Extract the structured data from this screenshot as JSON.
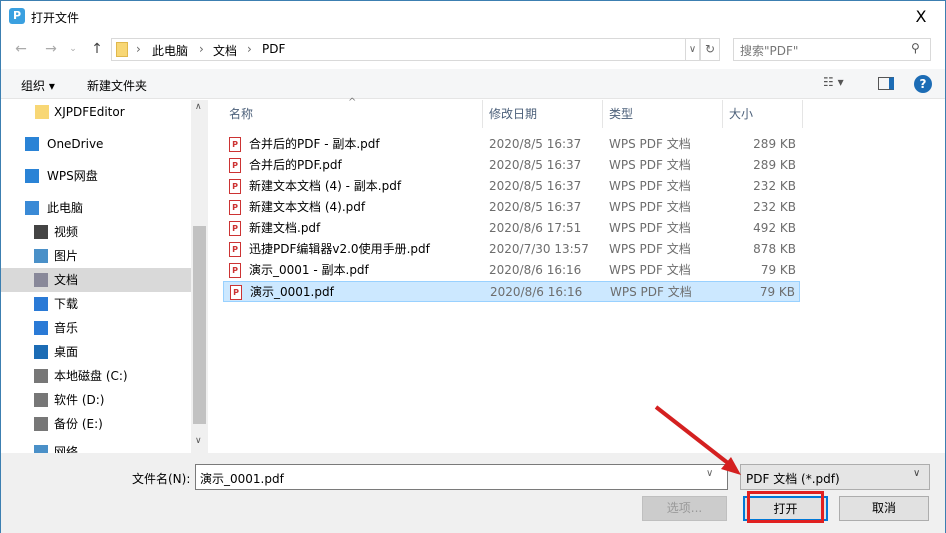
{
  "window": {
    "title": "打开文件",
    "close": "X"
  },
  "address": {
    "crumbs": [
      "此电脑",
      "文档",
      "PDF"
    ],
    "search_placeholder": "搜索\"PDF\""
  },
  "toolbar": {
    "organize": "组织 ▾",
    "new_folder": "新建文件夹"
  },
  "sidebar": {
    "items": [
      {
        "label": "XJPDFEditor",
        "icon": "folder-icon"
      },
      {
        "label": "OneDrive",
        "icon": "cloud-icon"
      },
      {
        "label": "WPS网盘",
        "icon": "cloud-icon"
      },
      {
        "label": "此电脑",
        "icon": "computer-icon"
      },
      {
        "label": "视频",
        "icon": "video-icon"
      },
      {
        "label": "图片",
        "icon": "picture-icon"
      },
      {
        "label": "文档",
        "icon": "document-icon"
      },
      {
        "label": "下载",
        "icon": "download-icon"
      },
      {
        "label": "音乐",
        "icon": "music-icon"
      },
      {
        "label": "桌面",
        "icon": "desktop-icon"
      },
      {
        "label": "本地磁盘 (C:)",
        "icon": "drive-icon"
      },
      {
        "label": "软件 (D:)",
        "icon": "drive-icon"
      },
      {
        "label": "备份 (E:)",
        "icon": "drive-icon"
      },
      {
        "label": "网络",
        "icon": "network-icon"
      }
    ]
  },
  "columns": [
    "名称",
    "修改日期",
    "类型",
    "大小"
  ],
  "files": [
    {
      "name": "合并后的PDF - 副本.pdf",
      "date": "2020/8/5 16:37",
      "type": "WPS PDF 文档",
      "size": "289 KB"
    },
    {
      "name": "合并后的PDF.pdf",
      "date": "2020/8/5 16:37",
      "type": "WPS PDF 文档",
      "size": "289 KB"
    },
    {
      "name": "新建文本文档 (4) - 副本.pdf",
      "date": "2020/8/5 16:37",
      "type": "WPS PDF 文档",
      "size": "232 KB"
    },
    {
      "name": "新建文本文档 (4).pdf",
      "date": "2020/8/5 16:37",
      "type": "WPS PDF 文档",
      "size": "232 KB"
    },
    {
      "name": "新建文档.pdf",
      "date": "2020/8/6 17:51",
      "type": "WPS PDF 文档",
      "size": "492 KB"
    },
    {
      "name": "迅捷PDF编辑器v2.0使用手册.pdf",
      "date": "2020/7/30 13:57",
      "type": "WPS PDF 文档",
      "size": "878 KB"
    },
    {
      "name": "演示_0001 - 副本.pdf",
      "date": "2020/8/6 16:16",
      "type": "WPS PDF 文档",
      "size": "79 KB"
    },
    {
      "name": "演示_0001.pdf",
      "date": "2020/8/6 16:16",
      "type": "WPS PDF 文档",
      "size": "79 KB"
    }
  ],
  "bottom": {
    "filename_label": "文件名(N):",
    "filename": "演示_0001.pdf",
    "filetype": "PDF 文档 (*.pdf)",
    "options": "选项...",
    "open": "打开",
    "cancel": "取消"
  }
}
